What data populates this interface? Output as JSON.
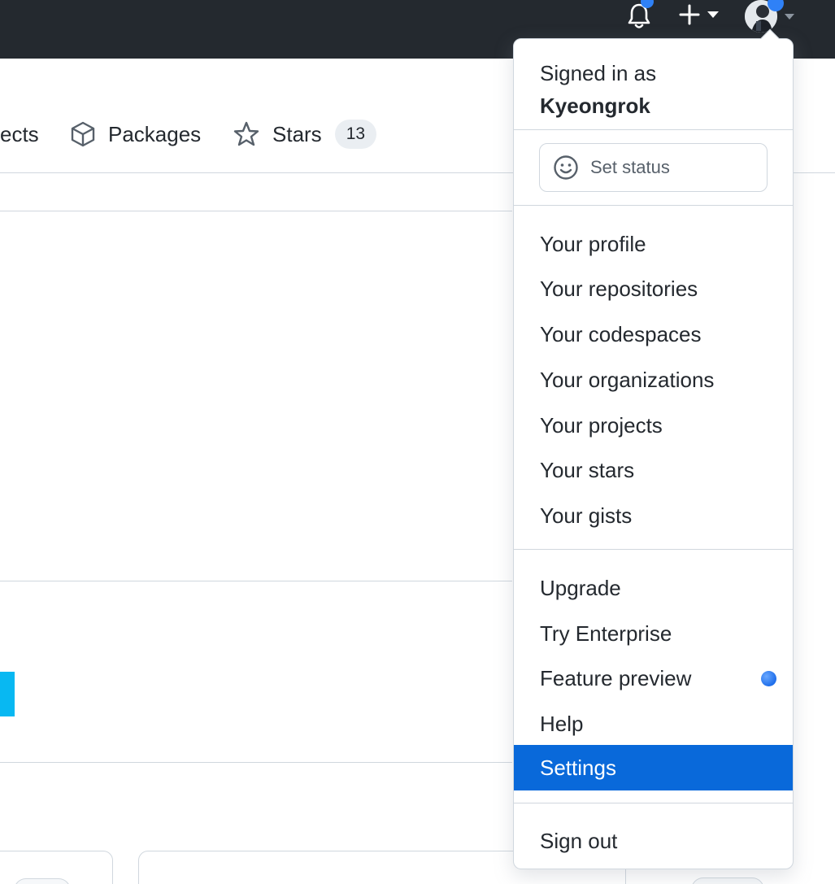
{
  "colors": {
    "header_bg": "#24292f",
    "accent_blue": "#0969da",
    "notification_dot": "#2f81f7",
    "side_block": "#08b8f2"
  },
  "header": {
    "icons": [
      "bell-icon",
      "plus-icon",
      "avatar"
    ]
  },
  "tabs": [
    {
      "label": "ects",
      "icon": "project-icon"
    },
    {
      "label": "Packages",
      "icon": "package-icon"
    },
    {
      "label": "Stars",
      "icon": "star-icon",
      "count": "13"
    }
  ],
  "dropdown": {
    "signed_in_prefix": "Signed in as",
    "username": "Kyeongrok",
    "set_status": "Set status",
    "profile_items": [
      "Your profile",
      "Your repositories",
      "Your codespaces",
      "Your organizations",
      "Your projects",
      "Your stars",
      "Your gists"
    ],
    "misc_items": [
      "Upgrade",
      "Try Enterprise",
      "Feature preview",
      "Help",
      "Settings"
    ],
    "active_item": "Settings",
    "sign_out": "Sign out"
  }
}
